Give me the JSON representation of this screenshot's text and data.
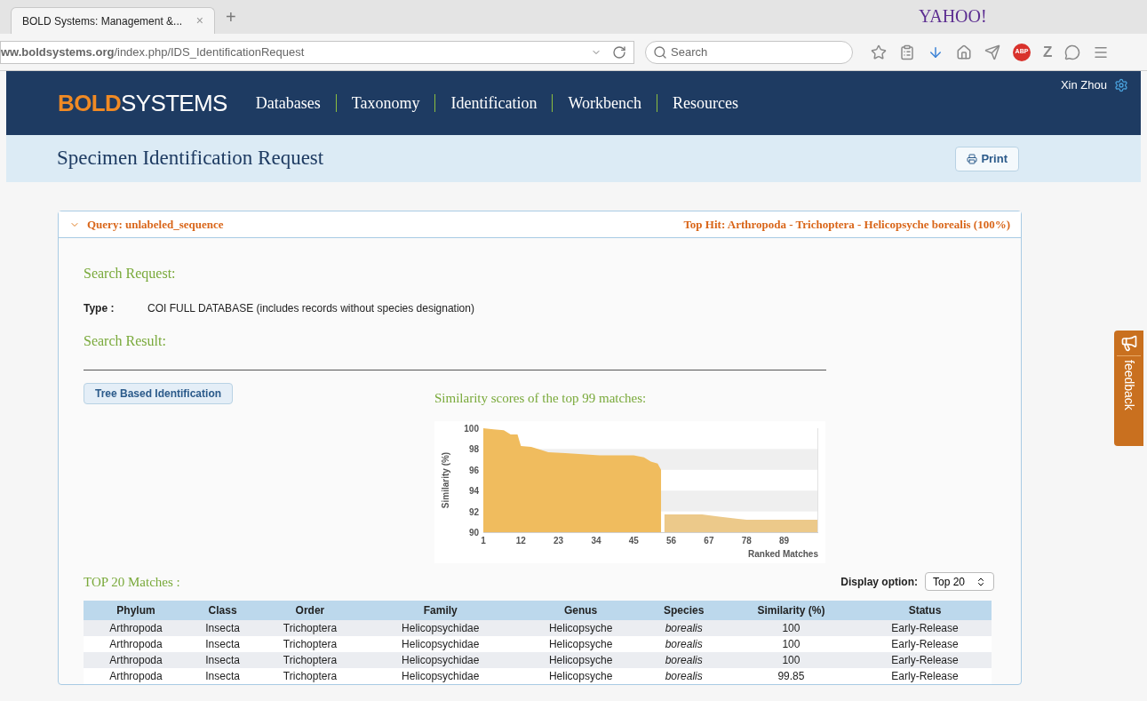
{
  "browser": {
    "tab": {
      "title": "BOLD Systems: Management &...",
      "close": "×"
    },
    "new_tab": "+",
    "brand": "YAHOO!",
    "url": "**ww.boldsystems.org**/index.php/IDS_IdentificationRequest",
    "search": {
      "placeholder": "Search"
    },
    "toolbar": [
      {
        "kind": "star"
      },
      {
        "kind": "reader"
      },
      {
        "kind": "download"
      },
      {
        "kind": "home"
      },
      {
        "kind": "send"
      },
      {
        "kind": "abp",
        "label": "ABP"
      },
      {
        "kind": "letter",
        "label": "Z"
      },
      {
        "kind": "chat"
      },
      {
        "kind": "menu"
      }
    ]
  },
  "nav": {
    "logo_bold": "BOLD",
    "logo_rest": "SYSTEMS",
    "items": [
      "Databases",
      "Taxonomy",
      "Identification",
      "Workbench",
      "Resources"
    ],
    "user": "Xin Zhou"
  },
  "page": {
    "title": "Specimen Identification Request",
    "print": "Print"
  },
  "panel": {
    "expanded": true,
    "query": "Query: unlabeled_sequence",
    "top_hit": "Top Hit: Arthropoda - Trichoptera - Helicopsyche borealis (100%)",
    "search_request": "Search Request:",
    "type_label": "Type :",
    "type_value": "COI FULL DATABASE (includes records without species designation)",
    "search_result": "Search Result:",
    "tree_button": "Tree Based Identification",
    "chart_title": "Similarity scores of the top 99 matches:",
    "chart_data": {
      "type": "area",
      "ylabel": "Similarity (%)",
      "xlabel": "Ranked Matches",
      "xlim": [
        1,
        99
      ],
      "ylim": [
        90,
        100
      ],
      "xticks": [
        1,
        12,
        23,
        34,
        45,
        56,
        67,
        78,
        89
      ],
      "yticks": [
        90,
        92,
        94,
        96,
        98,
        100
      ],
      "x": [
        1,
        4,
        7,
        9,
        11,
        12,
        15,
        18,
        20,
        25,
        35,
        45,
        48,
        50,
        52,
        53,
        54,
        55,
        65,
        70,
        75,
        78,
        99
      ],
      "series": [
        {
          "color": "#f0bc5e",
          "values": [
            100,
            99.9,
            99.8,
            99.4,
            99.4,
            98.3,
            98.2,
            97.9,
            97.7,
            97.6,
            97.4,
            97.4,
            97.2,
            96.8,
            96.6,
            96.0,
            null,
            null,
            null,
            null,
            null,
            null,
            null
          ]
        },
        {
          "color": "#ecc98a",
          "values": [
            null,
            null,
            null,
            null,
            null,
            null,
            null,
            null,
            null,
            null,
            null,
            null,
            null,
            null,
            null,
            null,
            91.7,
            91.7,
            91.7,
            91.5,
            91.3,
            91.2,
            91.2
          ]
        }
      ]
    },
    "matches_title": "TOP 20 Matches :",
    "display_label": "Display option:",
    "display_value": "Top 20",
    "columns": [
      "Phylum",
      "Class",
      "Order",
      "Family",
      "Genus",
      "Species",
      "Similarity (%)",
      "Status"
    ],
    "rows": [
      [
        "Arthropoda",
        "Insecta",
        "Trichoptera",
        "Helicopsychidae",
        "Helicopsyche",
        "borealis",
        "100",
        "Early-Release"
      ],
      [
        "Arthropoda",
        "Insecta",
        "Trichoptera",
        "Helicopsychidae",
        "Helicopsyche",
        "borealis",
        "100",
        "Early-Release"
      ],
      [
        "Arthropoda",
        "Insecta",
        "Trichoptera",
        "Helicopsychidae",
        "Helicopsyche",
        "borealis",
        "100",
        "Early-Release"
      ],
      [
        "Arthropoda",
        "Insecta",
        "Trichoptera",
        "Helicopsychidae",
        "Helicopsyche",
        "borealis",
        "99.85",
        "Early-Release"
      ]
    ]
  },
  "feedback": "feedback"
}
